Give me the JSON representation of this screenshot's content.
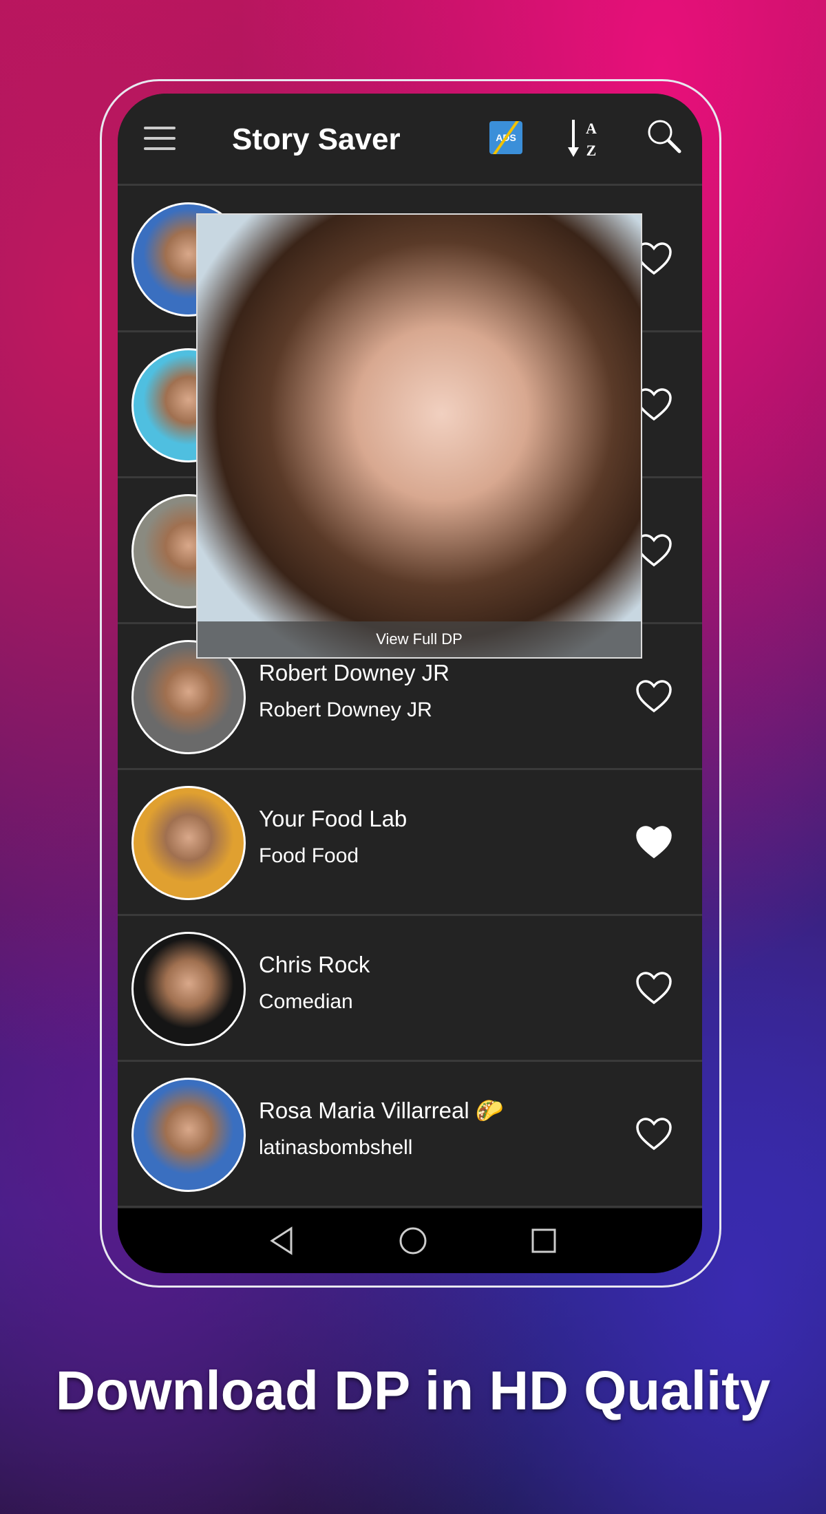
{
  "header": {
    "title": "Story Saver",
    "ads_label": "ADS",
    "sort_top": "A",
    "sort_bottom": "Z",
    "icons": [
      "menu-icon",
      "no-ads-icon",
      "sort-az-icon",
      "search-icon"
    ]
  },
  "list": [
    {
      "name": "",
      "subtitle": "",
      "favorite": false,
      "avatar_color": "#3a6fc0"
    },
    {
      "name": "",
      "subtitle": "",
      "favorite": false,
      "avatar_color": "#4fbfe0"
    },
    {
      "name": "",
      "subtitle": "",
      "favorite": false,
      "avatar_color": "#8a8a80"
    },
    {
      "name": "Robert Downey JR",
      "subtitle": "Robert Downey JR",
      "favorite": false,
      "avatar_color": "#6a6a6a"
    },
    {
      "name": "Your  Food Lab",
      "subtitle": "Food Food",
      "favorite": true,
      "avatar_color": "#e0a030"
    },
    {
      "name": "Chris Rock",
      "subtitle": "Comedian",
      "favorite": false,
      "avatar_color": "#151515"
    },
    {
      "name": "Rosa Maria Villarreal 🌮",
      "subtitle": "latinasbombshell",
      "favorite": false,
      "avatar_color": "#3a6fc0"
    }
  ],
  "popup": {
    "caption": "View Full DP"
  },
  "tagline": "Download DP in HD Quality"
}
